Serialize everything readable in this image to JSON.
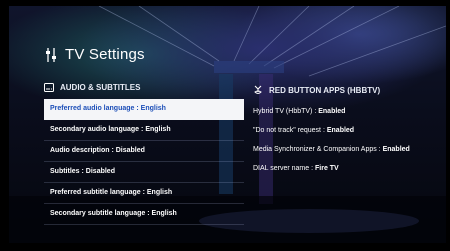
{
  "header": {
    "title": "TV Settings",
    "icon": "settings-sliders-icon"
  },
  "left_section": {
    "title": "AUDIO & SUBTITLES",
    "icon": "subtitles-icon",
    "items": [
      {
        "label": "Preferred audio language",
        "value": "English",
        "selected": true
      },
      {
        "label": "Secondary audio language",
        "value": "English"
      },
      {
        "label": "Audio description",
        "value": "Disabled"
      },
      {
        "label": "Subtitles",
        "value": "Disabled"
      },
      {
        "label": "Preferred subtitle language",
        "value": "English"
      },
      {
        "label": "Secondary subtitle language",
        "value": "English"
      }
    ]
  },
  "right_section": {
    "title": "RED BUTTON APPS (HBBTV)",
    "icon": "hbbtv-app-icon",
    "items": [
      {
        "label": "Hybrid TV (HbbTV)",
        "value": "Enabled"
      },
      {
        "label": "\"Do not track\" request",
        "value": "Enabled"
      },
      {
        "label": "Media Synchronizer & Companion Apps",
        "value": "Enabled"
      },
      {
        "label": "DIAL server name",
        "value": "Fire TV"
      }
    ]
  },
  "separator": " : ",
  "colors": {
    "highlight_bg": "#f4f5f8",
    "highlight_text": "#1d4fb8",
    "text": "#ffffff"
  }
}
